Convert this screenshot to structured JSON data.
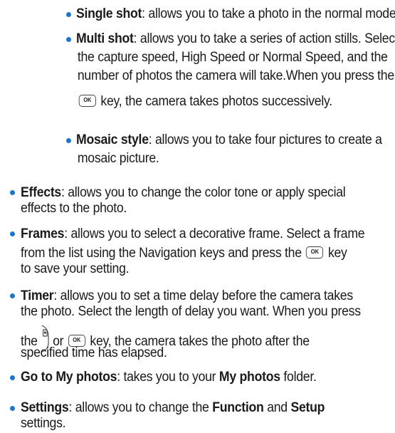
{
  "sub_items": [
    {
      "term": "Single shot",
      "text": [
        ": allows you to take a photo in the normal mode."
      ]
    },
    {
      "term": "Multi shot",
      "text": [
        ": allows you to take a series of action stills. Select",
        "the capture speed, High Speed or Normal Speed, and the",
        "number of photos the camera will take.When you press the"
      ],
      "after_key": "key, the camera takes photos successively."
    },
    {
      "term": "Mosaic style",
      "text": [
        ": allows you to take four pictures to create a",
        "mosaic picture."
      ]
    }
  ],
  "items": [
    {
      "term": "Effects",
      "lines": [
        ": allows you to change the color tone or apply special",
        "effects to the photo."
      ]
    },
    {
      "term": "Frames",
      "lines": [
        ": allows you to select a decorative frame. Select a frame",
        "from the list using the Navigation keys and press the",
        "key",
        "to save your setting."
      ]
    },
    {
      "term": "Timer",
      "lines": [
        ": allows you to set a time delay before the camera takes",
        "the photo. Select the length of delay you want. When you press",
        "the",
        "or",
        "key, the camera takes the photo after the",
        "specified time has elapsed."
      ]
    },
    {
      "term": "Go to My photos",
      "text_before": ": takes you to your",
      "bold": "My photos",
      "text_after": "folder."
    },
    {
      "term": "Settings",
      "text_before": ": allows you to change the",
      "bold1": "Function",
      "mid": "and",
      "bold2": "Setup",
      "line2": "settings."
    }
  ],
  "ok_key_label": "OK",
  "icons": {
    "ok_key": "ok-key-icon",
    "camera_side_key": "camera-side-key-icon"
  },
  "colors": {
    "bullet": "#1f76c8",
    "text": "#1a1a1a"
  }
}
